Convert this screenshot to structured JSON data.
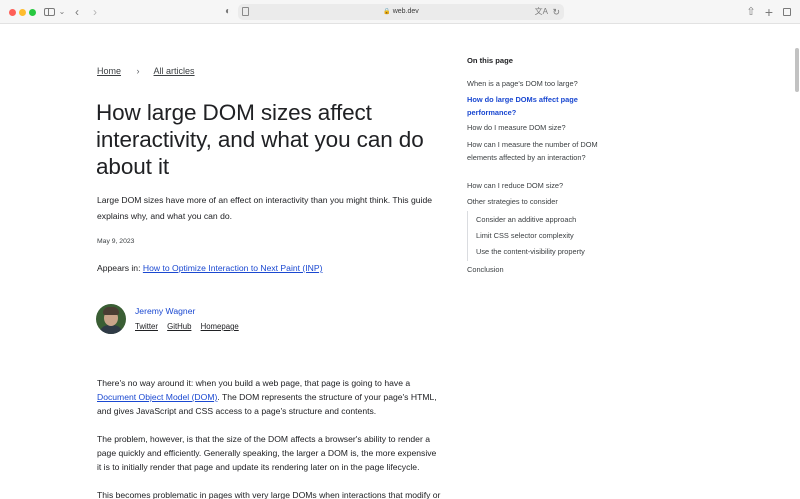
{
  "browser": {
    "url": "web.dev",
    "back_glyph": "‹",
    "forward_glyph": "›",
    "new_tab_glyph": "+",
    "colors": {
      "close": "#fe5f57",
      "minimize": "#febc2e",
      "maximize": "#28c840"
    }
  },
  "breadcrumb": {
    "home": "Home",
    "separator": "›",
    "all_articles": "All articles"
  },
  "article": {
    "title": "How large DOM sizes affect interactivity, and what you can do about it",
    "intro": "Large DOM sizes have more of an effect on interactivity than you might think. This guide explains why, and what you can do.",
    "date": "May 9, 2023",
    "appears_prefix": "Appears in: ",
    "appears_link": "How to Optimize Interaction to Next Paint (INP)",
    "author": {
      "name": "Jeremy Wagner",
      "links": [
        "Twitter",
        "GitHub",
        "Homepage"
      ]
    },
    "p1_before": "There's no way around it: when you build a web page, that page is going to have a ",
    "p1_link": "Document Object Model (DOM)",
    "p1_after": ". The DOM represents the structure of your page's HTML, and gives JavaScript and CSS access to a page's structure and contents.",
    "p2": "The problem, however, is that the size of the DOM affects a browser's ability to render a page quickly and efficiently. Generally speaking, the larger a DOM is, the more expensive it is to initially render that page and update its rendering later on in the page lifecycle.",
    "p3": "This becomes problematic in pages with very large DOMs when interactions that modify or"
  },
  "toc": {
    "heading": "On this page",
    "items": [
      "When is a page's DOM too large?",
      "How do large DOMs affect page performance?",
      "How do I measure DOM size?",
      "How can I measure the number of DOM elements affected by an interaction?",
      "How can I reduce DOM size?",
      "Other strategies to consider",
      "Consider an additive approach",
      "Limit CSS selector complexity",
      "Use the content-visibility property",
      "Conclusion"
    ],
    "active_color": "#1a48d1"
  }
}
